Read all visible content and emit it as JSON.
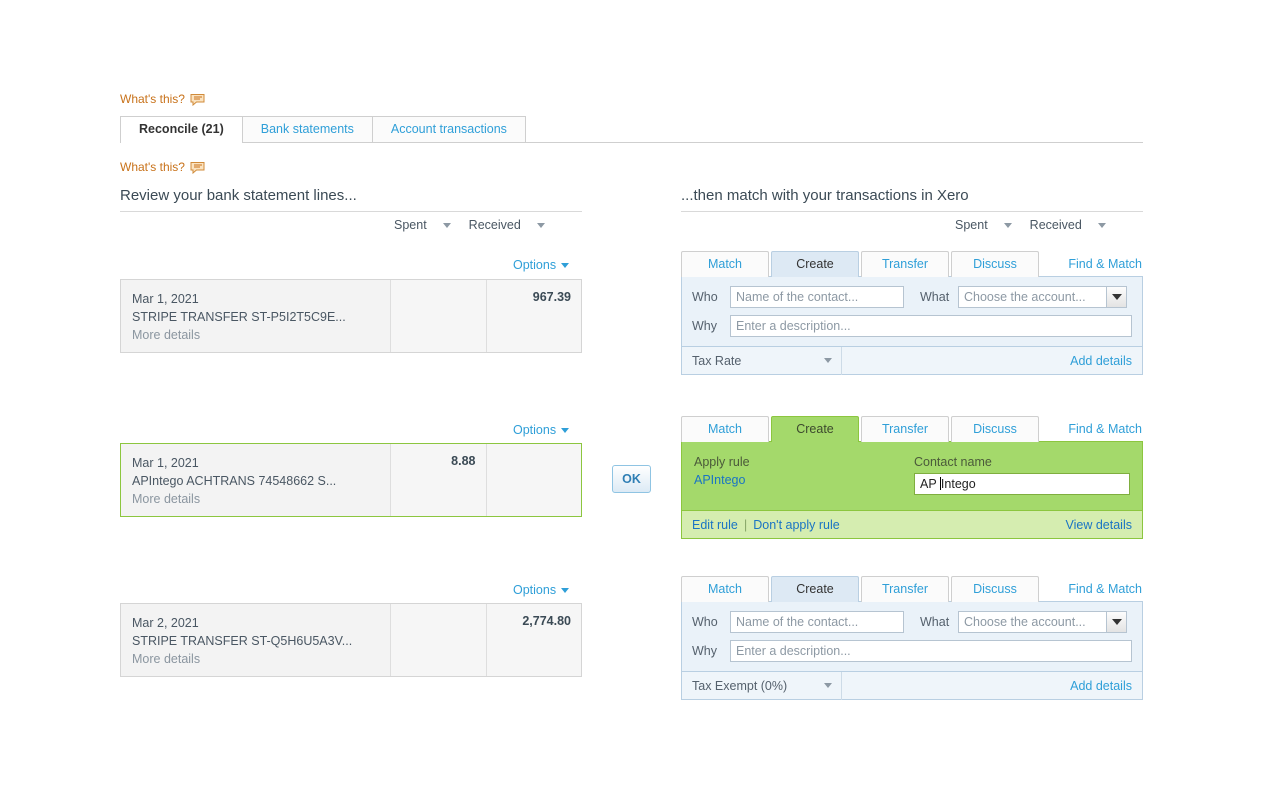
{
  "help": {
    "top_label": "What's this?",
    "second_label": "What's this?",
    "icon": "speech-bubble-icon",
    "color": "#c8721a"
  },
  "tabs": [
    {
      "label": "Reconcile (21)",
      "active": true
    },
    {
      "label": "Bank statements",
      "active": false
    },
    {
      "label": "Account transactions",
      "active": false
    }
  ],
  "left_column": {
    "heading": "Review your bank statement lines...",
    "amount_headers": {
      "spent": "Spent",
      "received": "Received"
    },
    "options_label": "Options",
    "statement_lines": [
      {
        "date": "Mar 1, 2021",
        "description": "STRIPE TRANSFER ST-P5I2T5C9E...",
        "more_details": "More details",
        "spent": "",
        "received": "967.39",
        "highlighted": false
      },
      {
        "date": "Mar 1, 2021",
        "description": "APIntego ACHTRANS 74548662 S...",
        "more_details": "More details",
        "spent": "8.88",
        "received": "",
        "highlighted": true
      },
      {
        "date": "Mar 2, 2021",
        "description": "STRIPE TRANSFER ST-Q5H6U5A3V...",
        "more_details": "More details",
        "spent": "",
        "received": "2,774.80",
        "highlighted": false
      }
    ]
  },
  "ok_button": {
    "label": "OK"
  },
  "right_column": {
    "heading": "...then match with your transactions in Xero",
    "amount_headers": {
      "spent": "Spent",
      "received": "Received"
    },
    "panel_tabs": [
      "Match",
      "Create",
      "Transfer",
      "Discuss"
    ],
    "find_and_match": "Find & Match",
    "panels": [
      {
        "type": "create",
        "active_tab": "Create",
        "who_label": "Who",
        "who_placeholder": "Name of the contact...",
        "what_label": "What",
        "what_placeholder": "Choose the account...",
        "why_label": "Why",
        "why_placeholder": "Enter a description...",
        "tax_value": "Tax Rate",
        "add_details": "Add details"
      },
      {
        "type": "rule",
        "active_tab": "Create",
        "apply_rule_label": "Apply rule",
        "rule_name": "APIntego",
        "contact_name_label": "Contact name",
        "contact_name_value_before_caret": "AP ",
        "contact_name_value_after_caret": "Intego",
        "edit_rule": "Edit rule",
        "dont_apply_rule": "Don't apply rule",
        "view_details": "View details"
      },
      {
        "type": "create",
        "active_tab": "Create",
        "who_label": "Who",
        "who_placeholder": "Name of the contact...",
        "what_label": "What",
        "what_placeholder": "Choose the account...",
        "why_label": "Why",
        "why_placeholder": "Enter a description...",
        "tax_value": "Tax Exempt (0%)",
        "add_details": "Add details"
      }
    ]
  },
  "colors": {
    "link": "#2f9fd8",
    "rule_green": "#a4d96b",
    "rule_green_border": "#8cc63f",
    "rule_footer_green": "#d5edb0",
    "help_orange": "#c8721a",
    "panel_blue": "#eaf2f9"
  }
}
